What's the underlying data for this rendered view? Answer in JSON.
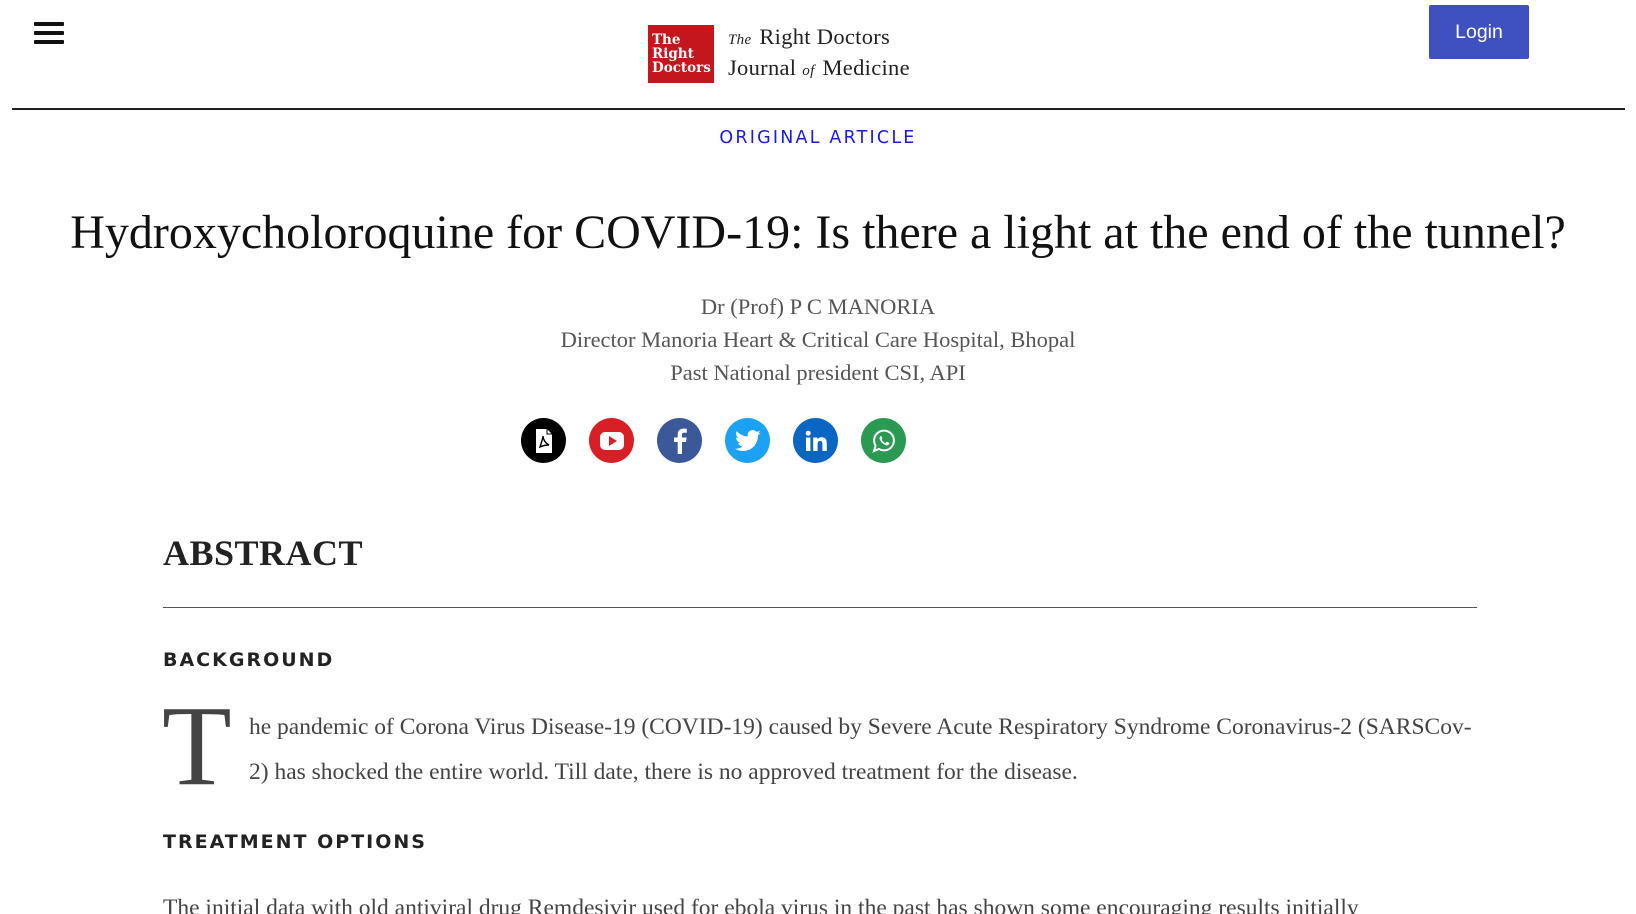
{
  "header": {
    "menu_icon": "hamburger-menu-icon",
    "logo": {
      "box_lines": [
        "The",
        "Right",
        "Doctors"
      ],
      "line1_prefix": "The",
      "line1_main": "Right Doctors",
      "line2_a": "Journal",
      "line2_of": "of",
      "line2_b": "Medicine"
    },
    "login_label": "Login",
    "colors": {
      "login_bg": "#3f51c0",
      "logo_red": "#c4161c"
    }
  },
  "article": {
    "category": "ORIGINAL ARTICLE",
    "title": "Hydroxycholoroquine for COVID-19: Is there a light at the end of the tunnel?",
    "authors": [
      "Dr (Prof) P C MANORIA",
      "Director Manoria Heart & Critical Care Hospital, Bhopal",
      "Past National president CSI, API"
    ],
    "share_icons": [
      "pdf-icon",
      "youtube-icon",
      "facebook-icon",
      "twitter-icon",
      "linkedin-icon",
      "whatsapp-icon"
    ]
  },
  "abstract": {
    "heading": "ABSTRACT",
    "background_heading": "BACKGROUND",
    "background_dropcap": "T",
    "background_text": "he pandemic of Corona Virus Disease-19 (COVID-19) caused by Severe Acute Respiratory Syndrome Coronavirus-2 (SARSCov-2) has shocked the entire world. Till date, there is no approved treatment for the disease.",
    "treatment_heading": "TREATMENT OPTIONS",
    "treatment_text": "The initial data with old antiviral drug Remdesivir used for ebola virus in the past has shown some encouraging results initially"
  }
}
